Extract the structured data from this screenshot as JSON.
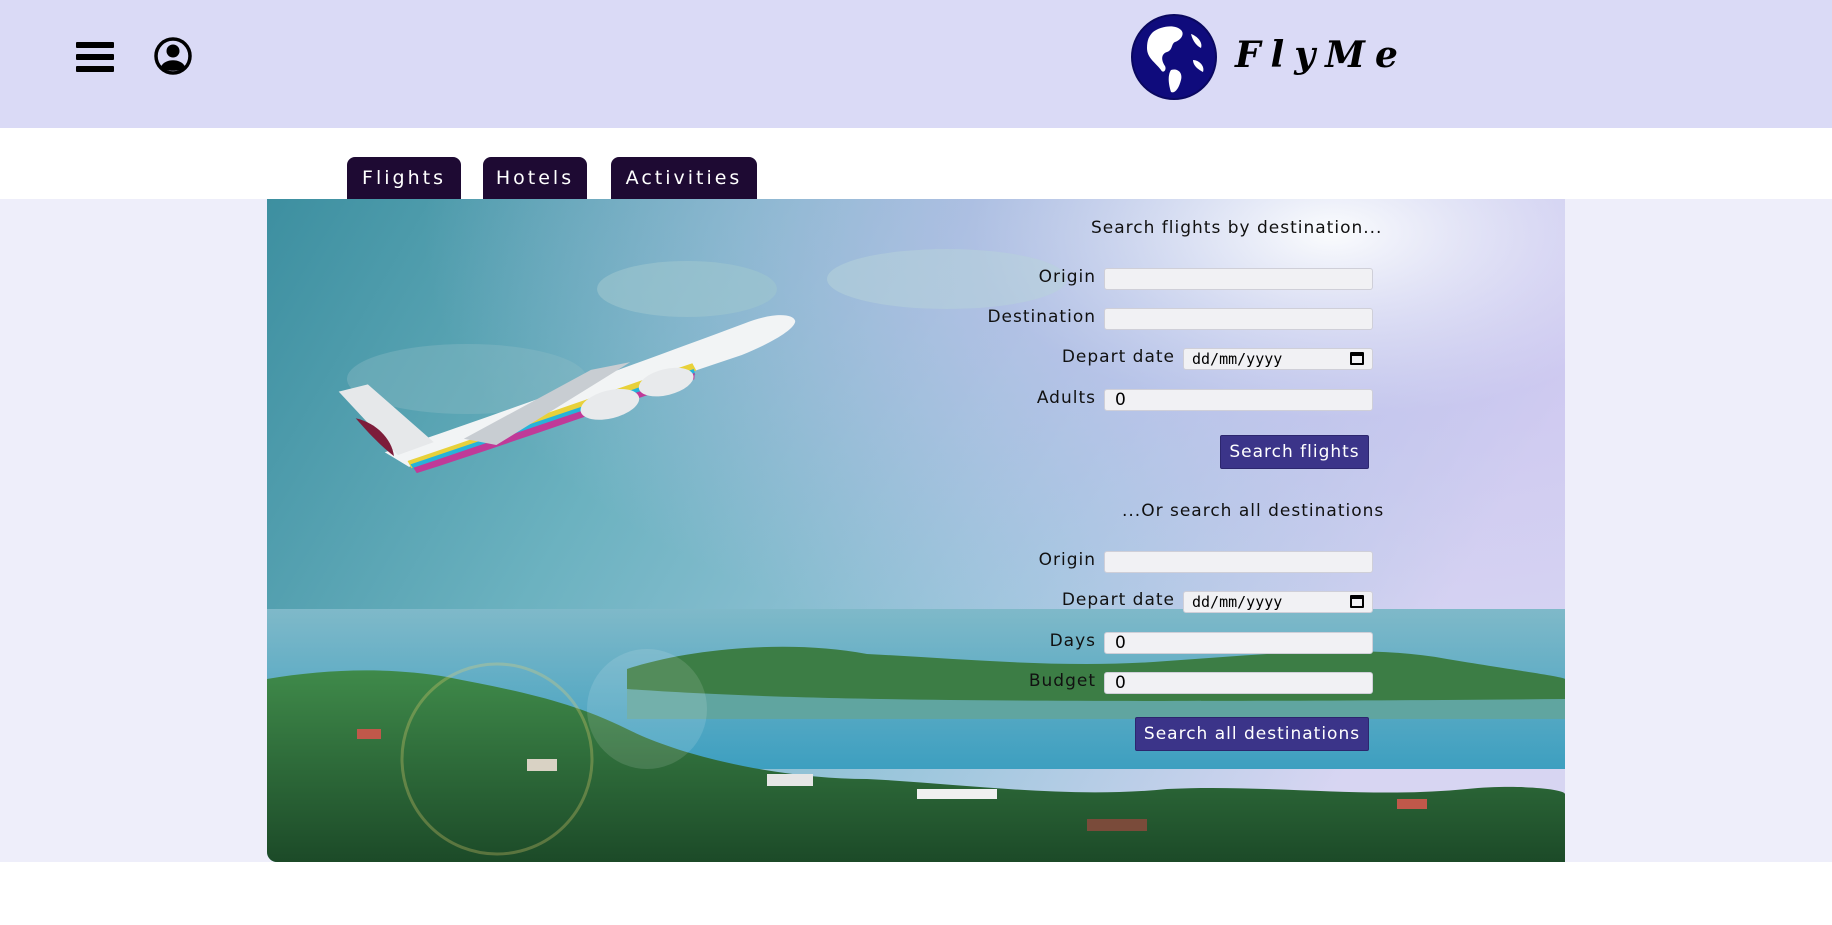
{
  "header": {
    "brand": "FlyMe",
    "menu_icon": "hamburger-menu-icon",
    "user_icon": "user-account-icon",
    "logo_icon": "globe-icon"
  },
  "tabs": [
    {
      "label": "Flights"
    },
    {
      "label": "Hotels"
    },
    {
      "label": "Activities"
    }
  ],
  "search_by_destination": {
    "title": "Search flights by destination...",
    "origin_label": "Origin",
    "origin_value": "",
    "destination_label": "Destination",
    "destination_value": "",
    "depart_date_label": "Depart date",
    "depart_date_placeholder": "dd/mm/yyyy",
    "adults_label": "Adults",
    "adults_value": "0",
    "submit_label": "Search flights"
  },
  "search_all": {
    "title": "...Or search all destinations",
    "origin_label": "Origin",
    "origin_value": "",
    "depart_date_label": "Depart date",
    "depart_date_placeholder": "dd/mm/yyyy",
    "days_label": "Days",
    "days_value": "0",
    "budget_label": "Budget",
    "budget_value": "0",
    "submit_label": "Search all destinations"
  },
  "colors": {
    "header_bg": "#dadaf6",
    "tab_bg": "#1e0a33",
    "button_bg": "#3b3489",
    "band_bg": "#eeeefa"
  }
}
